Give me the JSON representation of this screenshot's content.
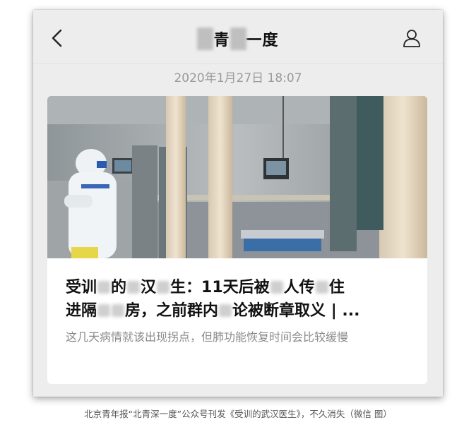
{
  "nav": {
    "title_segments": [
      "北",
      "青",
      "深",
      "一度"
    ],
    "back_icon": "chevron-left-icon",
    "profile_icon": "user-icon"
  },
  "date": "2020年1月27日 18:07",
  "article": {
    "headline_line1_parts": [
      "受训",
      "的",
      "汉",
      "生：11天后被",
      "人传",
      "住"
    ],
    "headline_line2_parts": [
      "进隔",
      "房，之前群内",
      "论被断章取义 | ..."
    ],
    "summary": "这几天病情就该出现拐点，但肺功能恢复时间会比较缓慢"
  },
  "caption": "北京青年报“北青深一度”公众号刊发《受训的武汉医生》，不久消失（微信 图）",
  "colors": {
    "background": "#ededed",
    "card": "#ffffff",
    "date": "#9a9a9a",
    "summary": "#8a8a8a"
  }
}
